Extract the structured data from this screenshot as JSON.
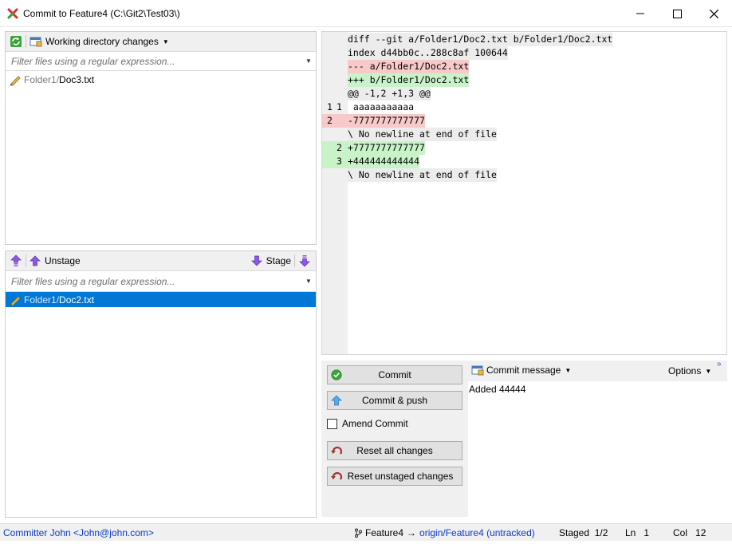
{
  "window": {
    "title": "Commit to Feature4 (C:\\Git2\\Test03\\)",
    "icons": {
      "app": "git-extensions-icon",
      "minimize": "minimize-icon",
      "maximize": "maximize-icon",
      "close": "close-icon"
    }
  },
  "unstaged": {
    "toolbar_label": "Working directory changes",
    "filter_placeholder": "Filter files using a regular expression...",
    "files": [
      {
        "dir": "Folder1/",
        "name": "Doc3.txt",
        "icon": "pencil-icon",
        "selected": false
      }
    ]
  },
  "staged": {
    "unstage_label": "Unstage",
    "stage_label": "Stage",
    "filter_placeholder": "Filter files using a regular expression...",
    "files": [
      {
        "dir": "Folder1/",
        "name": "Doc2.txt",
        "icon": "pencil-icon",
        "selected": true
      }
    ]
  },
  "diff": {
    "lines": [
      {
        "kind": "head",
        "old": "",
        "new": "",
        "text": "diff --git a/Folder1/Doc2.txt b/Folder1/Doc2.txt"
      },
      {
        "kind": "head",
        "old": "",
        "new": "",
        "text": "index d44bb0c..288c8af 100644"
      },
      {
        "kind": "rem-head",
        "old": "",
        "new": "",
        "text": "--- a/Folder1/Doc2.txt"
      },
      {
        "kind": "add-head",
        "old": "",
        "new": "",
        "text": "+++ b/Folder1/Doc2.txt"
      },
      {
        "kind": "head",
        "old": "",
        "new": "",
        "text": "@@ -1,2 +1,3 @@"
      },
      {
        "kind": "ctx",
        "old": "1",
        "new": "1",
        "text": " aaaaaaaaaaa"
      },
      {
        "kind": "rem",
        "old": "2",
        "new": "",
        "text": "-7777777777777"
      },
      {
        "kind": "head",
        "old": "",
        "new": "",
        "text": "\\ No newline at end of file"
      },
      {
        "kind": "add",
        "old": "",
        "new": "2",
        "text": "+7777777777777"
      },
      {
        "kind": "add",
        "old": "",
        "new": "3",
        "text": "+444444444444"
      },
      {
        "kind": "head",
        "old": "",
        "new": "",
        "text": "\\ No newline at end of file"
      }
    ]
  },
  "actions": {
    "commit": "Commit",
    "commit_push": "Commit & push",
    "amend": "Amend Commit",
    "amend_checked": false,
    "reset_all": "Reset all changes",
    "reset_unstaged": "Reset unstaged changes"
  },
  "message": {
    "toolbar_label": "Commit message",
    "options_label": "Options",
    "text": "Added 44444"
  },
  "status": {
    "committer": "Committer John <John@john.com>",
    "branch": "Feature4",
    "arrow": "→",
    "remote": "origin/Feature4 (untracked)",
    "staged_label": "Staged",
    "staged_value": "1/2",
    "ln_label": "Ln",
    "ln_value": "1",
    "col_label": "Col",
    "col_value": "12"
  },
  "colors": {
    "selection": "#0078d7",
    "diff_removed": "#f7c9c9",
    "diff_added": "#c8f3c8",
    "link": "#0b3bc9"
  }
}
